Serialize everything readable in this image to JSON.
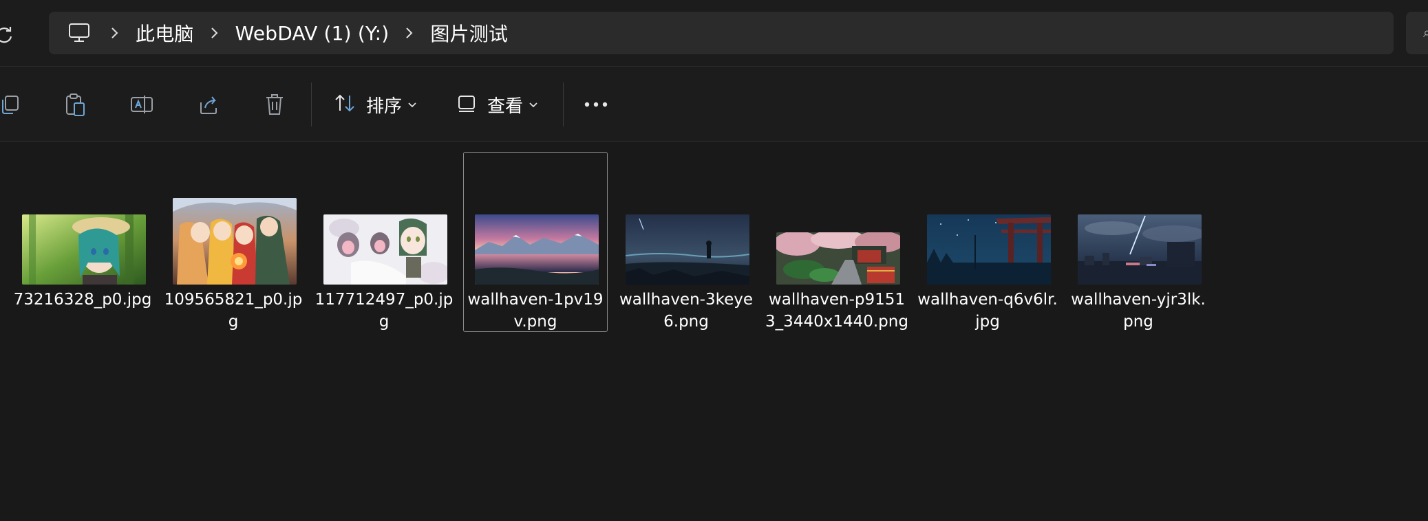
{
  "address_bar": {
    "breadcrumbs": [
      "此电脑",
      "WebDAV (1) (Y:)",
      "图片测试"
    ]
  },
  "toolbar": {
    "sort_label": "排序",
    "view_label": "查看"
  },
  "files": [
    {
      "name": "73216328_p0.jpg"
    },
    {
      "name": "109565821_p0.jpg"
    },
    {
      "name": "117712497_p0.jpg"
    },
    {
      "name": "wallhaven-1pv19v.png",
      "selected": true
    },
    {
      "name": "wallhaven-3keye6.png"
    },
    {
      "name": "wallhaven-p91513_3440x1440.png"
    },
    {
      "name": "wallhaven-q6v6lr.jpg"
    },
    {
      "name": "wallhaven-yjr3lk.png"
    }
  ],
  "colors": {
    "background": "#191919",
    "breadcrumb_bg": "#2b2b2b",
    "accent": "#60cdff"
  }
}
